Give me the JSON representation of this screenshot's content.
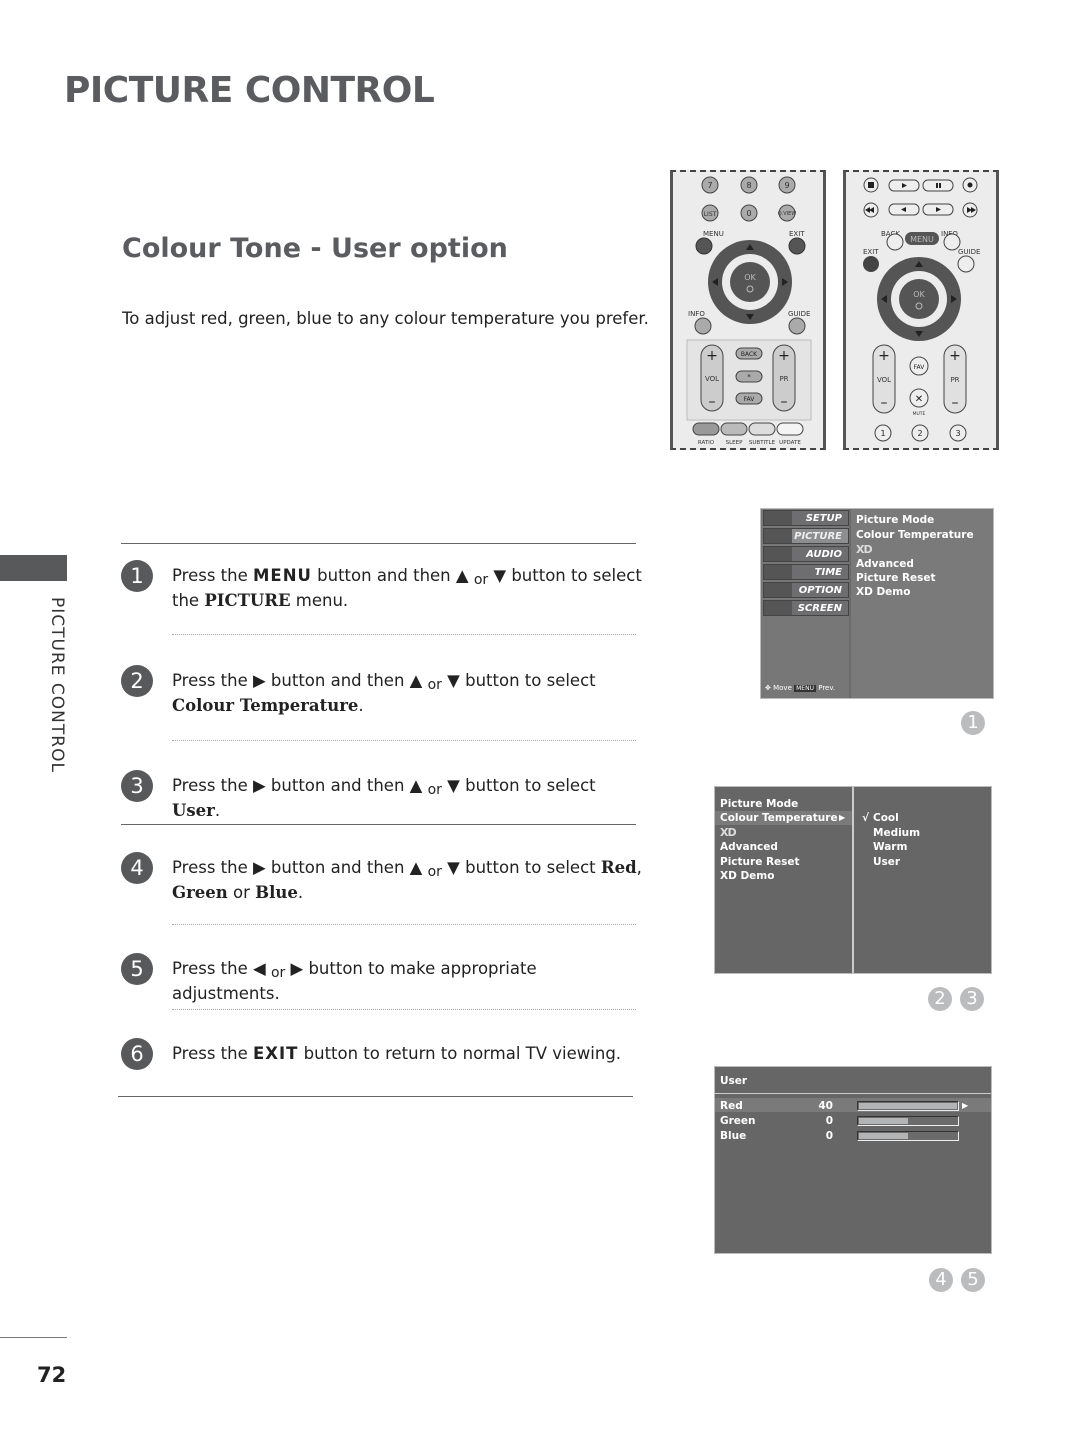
{
  "page": {
    "title": "PICTURE CONTROL",
    "section_title": "Colour Tone - User option",
    "intro": "To adjust red, green, blue to any colour temperature you prefer.",
    "side_label": "PICTURE CONTROL",
    "page_number": "72"
  },
  "steps": [
    {
      "num": "1",
      "parts": [
        "Press the ",
        "MENU",
        " button and then ▲ ",
        "or",
        " ▼ button to select the ",
        "PICTURE",
        " menu."
      ]
    },
    {
      "num": "2",
      "parts": [
        "Press the ▶ button and then ▲ ",
        "or",
        " ▼ button to select ",
        "Colour Temperature",
        "."
      ]
    },
    {
      "num": "3",
      "parts": [
        "Press the ▶ button and then ▲ ",
        "or",
        " ▼ button to select ",
        "User",
        "."
      ]
    },
    {
      "num": "4",
      "parts": [
        "Press the ▶ button and then ▲ ",
        "or",
        " ▼ button to select ",
        "Red",
        ", ",
        "Green",
        " or ",
        "Blue",
        "."
      ]
    },
    {
      "num": "5",
      "parts": [
        "Press the ◀ ",
        "or",
        " ▶ button to make appropriate adjustments."
      ]
    },
    {
      "num": "6",
      "parts": [
        "Press the ",
        "EXIT",
        " button to return to normal TV viewing."
      ]
    }
  ],
  "remote_a": {
    "digits": [
      "7",
      "8",
      "9",
      "LIST",
      "0",
      "Q.VIEW"
    ],
    "labels": {
      "menu": "MENU",
      "exit": "EXIT",
      "ok": "OK",
      "info": "INFO",
      "guide": "GUIDE",
      "back": "BACK",
      "star": "*",
      "fav": "FAV",
      "vol": "VOL",
      "pr": "PR",
      "ratio": "RATIO",
      "sleep": "SLEEP",
      "subtitle": "SUBTITLE",
      "update": "UPDATE"
    }
  },
  "remote_b": {
    "labels": {
      "back": "BACK",
      "menu": "MENU",
      "info": "INFO",
      "exit": "EXIT",
      "guide": "GUIDE",
      "ok": "OK",
      "vol": "VOL",
      "pr": "PR",
      "fav": "FAV",
      "mute": "MUTE"
    },
    "digits": [
      "1",
      "2",
      "3"
    ]
  },
  "osd1": {
    "main_menu": [
      "SETUP",
      "PICTURE",
      "AUDIO",
      "TIME",
      "OPTION",
      "SCREEN"
    ],
    "active": "PICTURE",
    "sub_items": [
      "Picture Mode",
      "Colour Temperature",
      "XD",
      "Advanced",
      "Picture Reset",
      "XD Demo"
    ],
    "footer_move": "Move",
    "footer_menu": "MENU",
    "footer_prev": "Prev.",
    "badge": "1"
  },
  "osd2": {
    "items": [
      "Picture Mode",
      "Colour Temperature",
      "XD",
      "Advanced",
      "Picture Reset",
      "XD Demo"
    ],
    "highlighted": "Colour Temperature",
    "options": [
      "Cool",
      "Medium",
      "Warm",
      "User"
    ],
    "checked": "Cool",
    "check_mark": "√",
    "arrow": "▶",
    "badges": [
      "2",
      "3"
    ]
  },
  "osd3": {
    "title": "User",
    "rows": [
      {
        "label": "Red",
        "value": "40",
        "level": 1.0,
        "selected": true
      },
      {
        "label": "Green",
        "value": "0",
        "level": 0.5,
        "selected": false
      },
      {
        "label": "Blue",
        "value": "0",
        "level": 0.5,
        "selected": false
      }
    ],
    "arrow": "▶",
    "badges": [
      "4",
      "5"
    ]
  }
}
